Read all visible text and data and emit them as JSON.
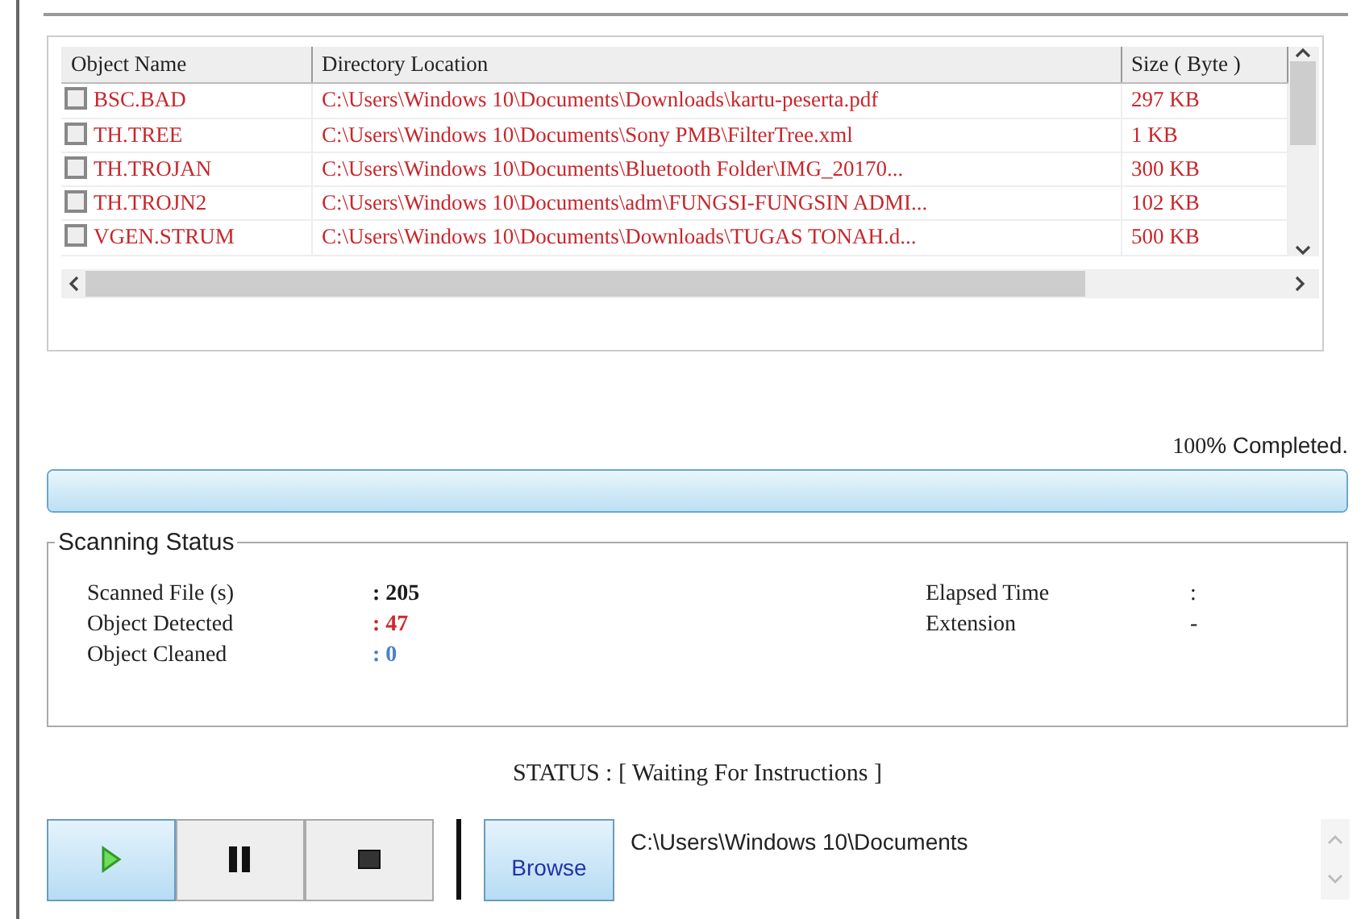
{
  "results_table": {
    "columns": [
      "Object Name",
      "Directory Location",
      "Size ( Byte )"
    ],
    "rows": [
      {
        "checked": false,
        "name": "BSC.BAD",
        "location": "C:\\Users\\Windows 10\\Documents\\Downloads\\kartu-peserta.pdf",
        "size": "297 KB"
      },
      {
        "checked": false,
        "name": "TH.TREE",
        "location": "C:\\Users\\Windows 10\\Documents\\Sony PMB\\FilterTree.xml",
        "size": "1 KB"
      },
      {
        "checked": false,
        "name": "TH.TROJAN",
        "location": "C:\\Users\\Windows 10\\Documents\\Bluetooth Folder\\IMG_20170...",
        "size": "300 KB"
      },
      {
        "checked": false,
        "name": "TH.TROJN2",
        "location": "C:\\Users\\Windows 10\\Documents\\adm\\FUNGSI-FUNGSIN ADMI...",
        "size": "102 KB"
      },
      {
        "checked": false,
        "name": "VGEN.STRUM",
        "location": "C:\\Users\\Windows 10\\Documents\\Downloads\\TUGAS TONAH.d...",
        "size": "500 KB"
      }
    ]
  },
  "progress": {
    "percent": "100",
    "label": "% Completed.",
    "level": 1
  },
  "scanning_status": {
    "title": "Scanning Status",
    "left": [
      {
        "label": "Scanned File  (s)",
        "value": ": 205",
        "color": "#1a1a1a"
      },
      {
        "label": "Object Detected",
        "value": ": 47",
        "color": "#d0282a"
      },
      {
        "label": "Object Cleaned",
        "value": ": 0",
        "color": "#4a7fd0"
      }
    ],
    "right": [
      {
        "label": "Elapsed Time",
        "value": ":"
      },
      {
        "label": "Extension",
        "value": "-"
      }
    ]
  },
  "status": "STATUS : [ Waiting For Instructions ]",
  "controls": [
    {
      "kind": "play",
      "selected": true
    },
    {
      "kind": "pause",
      "selected": false
    },
    {
      "kind": "stop",
      "selected": false
    }
  ],
  "browse_button": "Browse",
  "path": "C:\\Users\\Windows 10\\Documents"
}
